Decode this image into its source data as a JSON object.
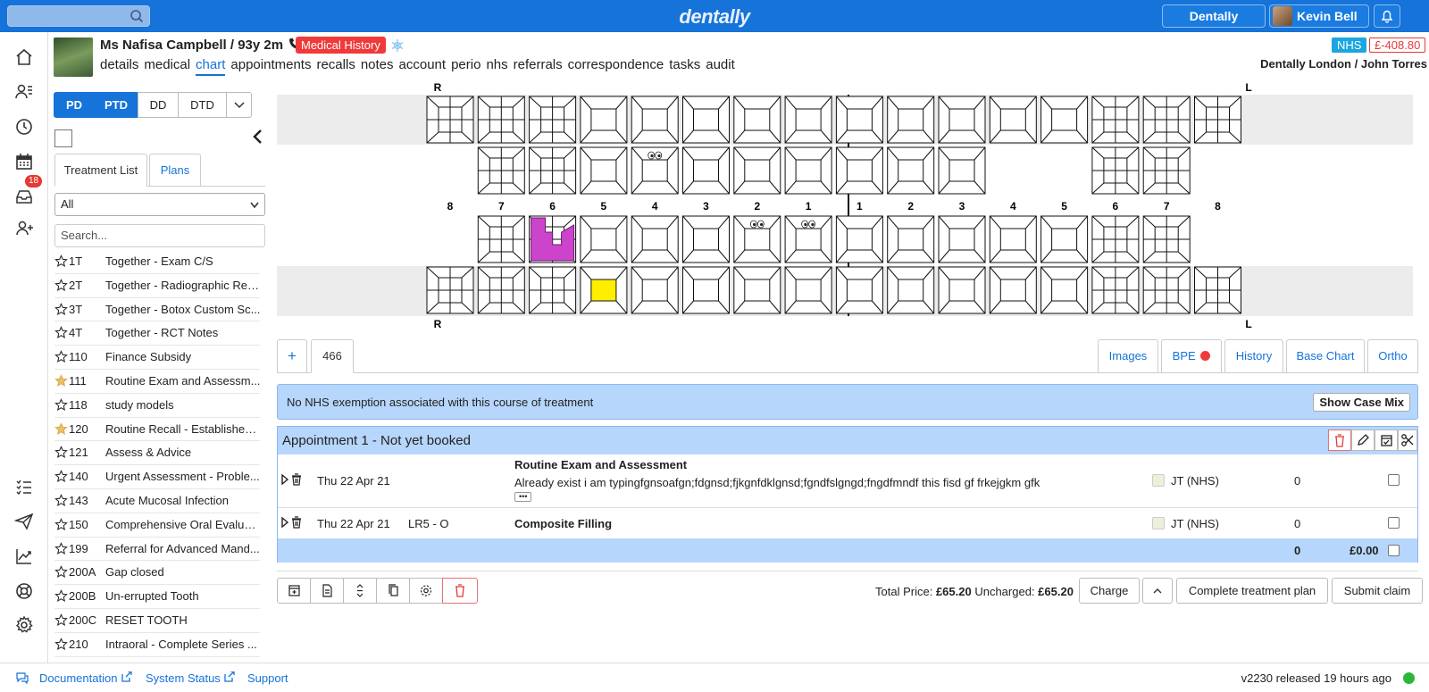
{
  "app": {
    "logo": "dentally"
  },
  "topbar": {
    "practice_button": "Dentally London",
    "user_name": "Kevin Bell"
  },
  "leftnav": {
    "inbox_badge": "18"
  },
  "patient": {
    "name": "Ms Nafisa Campbell / 93y 2m",
    "medical_history": "Medical History",
    "nhs_badge": "NHS",
    "balance": "£-408.80",
    "practice_provider": "Dentally London / John Torres",
    "tabs": [
      "details",
      "medical",
      "chart",
      "appointments",
      "recalls",
      "notes",
      "account",
      "perio",
      "nhs",
      "referrals",
      "correspondence",
      "tasks",
      "audit"
    ]
  },
  "chart_mode": {
    "options": [
      "PD",
      "PTD",
      "DD",
      "DTD"
    ]
  },
  "treatment_panel": {
    "tab_list": "Treatment List",
    "tab_plans": "Plans",
    "filter_value": "All",
    "search_placeholder": "Search...",
    "items": [
      {
        "code": "1T",
        "name": "Together - Exam C/S",
        "fav": false
      },
      {
        "code": "2T",
        "name": "Together - Radiographic Rep...",
        "fav": false
      },
      {
        "code": "3T",
        "name": "Together - Botox Custom Sc...",
        "fav": false
      },
      {
        "code": "4T",
        "name": "Together - RCT Notes",
        "fav": false
      },
      {
        "code": "110",
        "name": "Finance Subsidy",
        "fav": false
      },
      {
        "code": "111",
        "name": "Routine Exam and Assessm...",
        "fav": true
      },
      {
        "code": "118",
        "name": "study models",
        "fav": false
      },
      {
        "code": "120",
        "name": "Routine Recall - Established ...",
        "fav": true
      },
      {
        "code": "121",
        "name": "Assess & Advice",
        "fav": false
      },
      {
        "code": "140",
        "name": "Urgent Assessment - Proble...",
        "fav": false
      },
      {
        "code": "143",
        "name": "Acute Mucosal Infection",
        "fav": false
      },
      {
        "code": "150",
        "name": "Comprehensive Oral Evaluati...",
        "fav": false
      },
      {
        "code": "199",
        "name": "Referral for Advanced Mand...",
        "fav": false
      },
      {
        "code": "200A",
        "name": "Gap closed",
        "fav": false
      },
      {
        "code": "200B",
        "name": "Un-errupted Tooth",
        "fav": false
      },
      {
        "code": "200C",
        "name": "RESET TOOTH",
        "fav": false
      },
      {
        "code": "210",
        "name": "Intraoral - Complete Series ...",
        "fav": false
      }
    ]
  },
  "odontogram": {
    "side_right": "R",
    "side_left": "L",
    "numbers": [
      "8",
      "7",
      "6",
      "5",
      "4",
      "3",
      "2",
      "1",
      "1",
      "2",
      "3",
      "4",
      "5",
      "6",
      "7",
      "8"
    ]
  },
  "plan_tabs": {
    "add": "+",
    "current": "466",
    "right": [
      "Images",
      "BPE",
      "History",
      "Base Chart",
      "Ortho"
    ]
  },
  "nhs_notice": {
    "message": "No NHS exemption associated with this course of treatment",
    "button": "Show Case Mix"
  },
  "appointment": {
    "title": "Appointment 1 - Not yet booked",
    "rows": [
      {
        "date": "Thu 22 Apr 21",
        "tooth": "",
        "treatment": "Routine Exam and Assessment",
        "note": "Already exist i am typingfgnsoafgn;fdgnsd;fjkgnfdklgnsd;fgndfslgngd;fngdfmndf this fisd gf frkejgkm gfk",
        "more": "•••",
        "provider": "JT (NHS)",
        "qty": "0"
      },
      {
        "date": "Thu 22 Apr 21",
        "tooth": "LR5 - O",
        "treatment": "Composite Filling",
        "note": "",
        "more": "",
        "provider": "JT (NHS)",
        "qty": "0"
      }
    ],
    "footer_qty": "0",
    "footer_total": "£0.00"
  },
  "totals": {
    "total_label": "Total Price:",
    "total_value": "£65.20",
    "uncharged_label": "Uncharged:",
    "uncharged_value": "£65.20"
  },
  "actions": {
    "charge": "Charge",
    "complete": "Complete treatment plan",
    "submit": "Submit claim"
  },
  "footer": {
    "documentation": "Documentation",
    "system_status": "System Status",
    "support": "Support",
    "version": "v2230 released 19 hours ago"
  },
  "colors": {
    "brand": "#1573d9",
    "pad_purple": "#cc44cc",
    "yellow_fill": "#ffee00",
    "alert_red": "#f03a3a",
    "status_green": "#2db53c"
  }
}
